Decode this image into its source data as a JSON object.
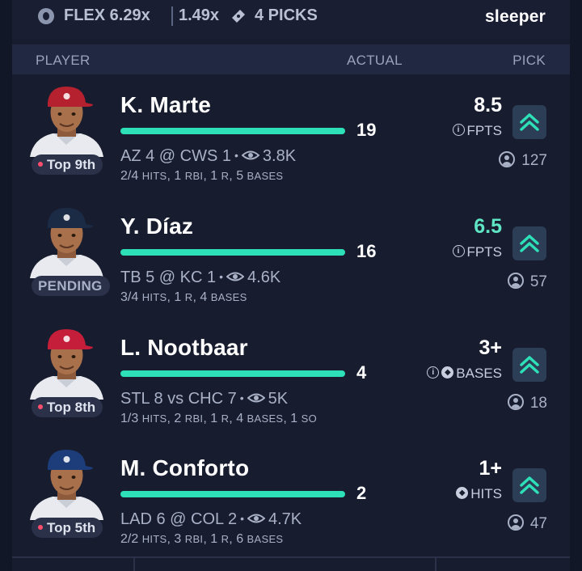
{
  "summary": {
    "flex_label": "FLEX 6.29x",
    "alt_multiplier": "1.49x",
    "picks_label": "4 PICKS",
    "brand": "sleeper"
  },
  "table_header": {
    "player": "PLAYER",
    "actual": "ACTUAL",
    "pick": "PICK"
  },
  "colors": {
    "accent_green": "#2ee0b8",
    "background": "#171c2f",
    "header_bg": "#212841"
  },
  "rows": [
    {
      "name": "K. Marte",
      "tag": "Top 9th",
      "tag_live": true,
      "actual": "19",
      "game": "AZ 4 @ CWS 1",
      "views": "3.8K",
      "stats": [
        [
          "2/4",
          "HITS"
        ],
        [
          "1",
          "RBI"
        ],
        [
          "1",
          "R"
        ],
        [
          "5",
          "BASES"
        ]
      ],
      "line": "8.5",
      "market": "FPTS",
      "pick_count": "127",
      "cap_color": "#b5212e"
    },
    {
      "name": "Y. Díaz",
      "tag": "PENDING",
      "tag_live": false,
      "actual": "16",
      "game": "TB 5 @ KC 1",
      "views": "4.6K",
      "stats": [
        [
          "3/4",
          "HITS"
        ],
        [
          "1",
          "R"
        ],
        [
          "4",
          "BASES"
        ]
      ],
      "line": "6.5",
      "market": "FPTS",
      "pick_count": "57",
      "cap_color": "#1b2a45"
    },
    {
      "name": "L. Nootbaar",
      "tag": "Top 8th",
      "tag_live": true,
      "actual": "4",
      "game": "STL 8 vs CHC 7",
      "views": "5K",
      "stats": [
        [
          "1/3",
          "HITS"
        ],
        [
          "2",
          "RBI"
        ],
        [
          "1",
          "R"
        ],
        [
          "4",
          "BASES"
        ],
        [
          "1",
          "SO"
        ]
      ],
      "line": "3+",
      "market": "BASES",
      "pick_count": "18",
      "cap_color": "#c41e3a"
    },
    {
      "name": "M. Conforto",
      "tag": "Top 5th",
      "tag_live": true,
      "actual": "2",
      "game": "LAD 6 @ COL 2",
      "views": "4.7K",
      "stats": [
        [
          "2/2",
          "HITS"
        ],
        [
          "3",
          "RBI"
        ],
        [
          "1",
          "R"
        ],
        [
          "6",
          "BASES"
        ]
      ],
      "line": "1+",
      "market": "HITS",
      "pick_count": "47",
      "cap_color": "#1d3c7a"
    }
  ]
}
